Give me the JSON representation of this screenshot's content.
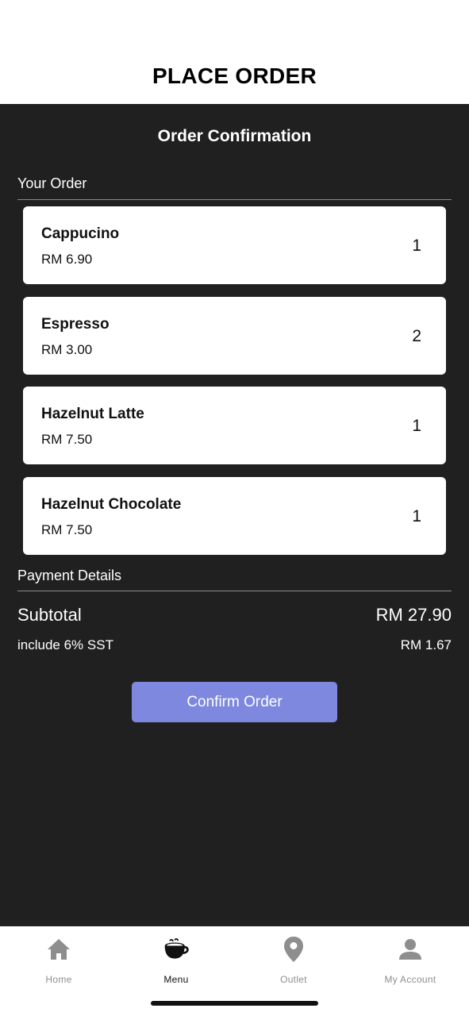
{
  "header": {
    "title": "PLACE ORDER"
  },
  "main": {
    "title": "Order Confirmation",
    "your_order_label": "Your Order",
    "items": [
      {
        "name": "Cappucino",
        "price": "RM 6.90",
        "qty": "1"
      },
      {
        "name": "Espresso",
        "price": "RM 3.00",
        "qty": "2"
      },
      {
        "name": "Hazelnut Latte",
        "price": "RM 7.50",
        "qty": "1"
      },
      {
        "name": "Hazelnut Chocolate",
        "price": "RM 7.50",
        "qty": "1"
      }
    ],
    "payment_label": "Payment Details",
    "subtotal_label": "Subtotal",
    "subtotal_value": "RM 27.90",
    "sst_label": "include 6% SST",
    "sst_value": "RM 1.67",
    "confirm_label": "Confirm Order"
  },
  "tabbar": {
    "tabs": [
      {
        "label": "Home",
        "icon": "home-icon",
        "active": false
      },
      {
        "label": "Menu",
        "icon": "coffee-cup-icon",
        "active": true
      },
      {
        "label": "Outlet",
        "icon": "location-pin-icon",
        "active": false
      },
      {
        "label": "My Account",
        "icon": "person-icon",
        "active": false
      }
    ]
  },
  "colors": {
    "background_dark": "#202020",
    "button_accent": "#7d88de",
    "tab_inactive": "#8e8e8e",
    "tab_active": "#111111"
  }
}
